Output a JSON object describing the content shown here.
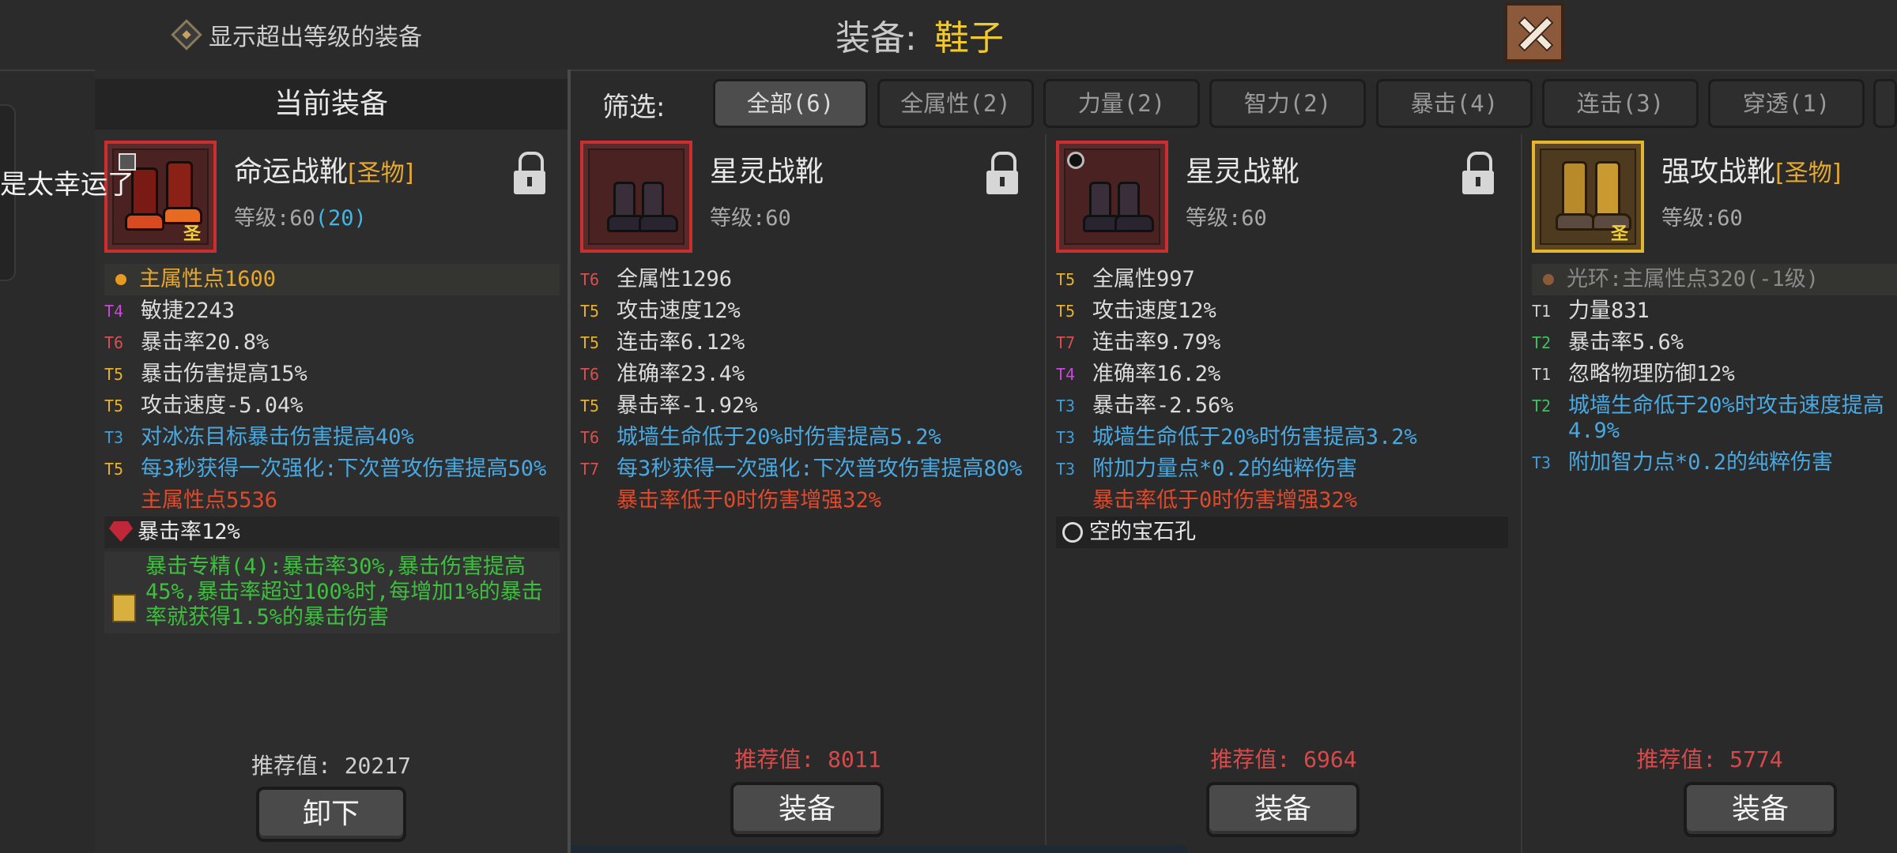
{
  "header": {
    "show_over_level_label": "显示超出等级的装备",
    "title_prefix": "装备:",
    "title_category": "鞋子",
    "close_icon": "close-x-icon"
  },
  "left_overlay_text": "是太幸运了",
  "current": {
    "header": "当前装备",
    "item": {
      "name": "命运战靴",
      "relic_tag": "[圣物]",
      "holy_mark": "圣",
      "level_prefix": "等级:60",
      "level_extra": "(20)",
      "frame_color": "#c92f2f",
      "stats": [
        {
          "tier": "",
          "text": "主属性点1600",
          "color": "#e6a830",
          "marker": "orb",
          "highlight": true
        },
        {
          "tier": "T4",
          "tier_color": "#c84ad8",
          "text": "敏捷2243",
          "color": "#dcdcdc"
        },
        {
          "tier": "T6",
          "tier_color": "#d85050",
          "text": "暴击率20.8%",
          "color": "#dcdcdc"
        },
        {
          "tier": "T5",
          "tier_color": "#e6b030",
          "text": "暴击伤害提高15%",
          "color": "#dcdcdc"
        },
        {
          "tier": "T5",
          "tier_color": "#e6b030",
          "text": "攻击速度-5.04%",
          "color": "#dcdcdc"
        },
        {
          "tier": "T3",
          "tier_color": "#3f9ed8",
          "text": "对冰冻目标暴击伤害提高40%",
          "color": "#4aa8e0"
        },
        {
          "tier": "T5",
          "tier_color": "#e6b030",
          "text": "每3秒获得一次强化:下次普攻伤害提高50%",
          "color": "#4aa8e0"
        },
        {
          "tier": "",
          "text": "主属性点5536",
          "color": "#e04a2a"
        }
      ],
      "gem": {
        "label": "暴击率12%"
      },
      "set_bonus": "暴击专精(4):暴击率30%,暴击伤害提高45%,暴击率超过100%时,每增加1%的暴击率就获得1.5%的暴击伤害"
    },
    "recommend": "推荐值: 20217",
    "button": "卸下"
  },
  "filter": {
    "label": "筛选:",
    "tabs": [
      {
        "label": "全部(6)",
        "active": true
      },
      {
        "label": "全属性(2)",
        "active": false
      },
      {
        "label": "力量(2)",
        "active": false
      },
      {
        "label": "智力(2)",
        "active": false
      },
      {
        "label": "暴击(4)",
        "active": false
      },
      {
        "label": "连击(3)",
        "active": false
      },
      {
        "label": "穿透(1)",
        "active": false
      }
    ]
  },
  "cards": [
    {
      "name": "星灵战靴",
      "relic_tag": "",
      "level": "等级:60",
      "stats": [
        {
          "tier": "T6",
          "tier_color": "#d85050",
          "text": "全属性1296",
          "color": "#dcdcdc"
        },
        {
          "tier": "T5",
          "tier_color": "#e6b030",
          "text": "攻击速度12%",
          "color": "#dcdcdc"
        },
        {
          "tier": "T5",
          "tier_color": "#e6b030",
          "text": "连击率6.12%",
          "color": "#dcdcdc"
        },
        {
          "tier": "T6",
          "tier_color": "#d85050",
          "text": "准确率23.4%",
          "color": "#dcdcdc"
        },
        {
          "tier": "T5",
          "tier_color": "#e6b030",
          "text": "暴击率-1.92%",
          "color": "#dcdcdc"
        },
        {
          "tier": "T6",
          "tier_color": "#d85050",
          "text": "城墙生命低于20%时伤害提高5.2%",
          "color": "#4aa8e0"
        },
        {
          "tier": "T7",
          "tier_color": "#d85050",
          "text": "每3秒获得一次强化:下次普攻伤害提高80%",
          "color": "#4aa8e0"
        },
        {
          "tier": "",
          "text": "暴击率低于0时伤害增强32%",
          "color": "#e04a2a"
        }
      ],
      "recommend": "推荐值: 8011",
      "button": "装备"
    },
    {
      "name": "星灵战靴",
      "relic_tag": "",
      "level": "等级:60",
      "stats": [
        {
          "tier": "T5",
          "tier_color": "#e6b030",
          "text": "全属性997",
          "color": "#dcdcdc"
        },
        {
          "tier": "T5",
          "tier_color": "#e6b030",
          "text": "攻击速度12%",
          "color": "#dcdcdc"
        },
        {
          "tier": "T7",
          "tier_color": "#d85050",
          "text": "连击率9.79%",
          "color": "#dcdcdc"
        },
        {
          "tier": "T4",
          "tier_color": "#c84ad8",
          "text": "准确率16.2%",
          "color": "#dcdcdc"
        },
        {
          "tier": "T3",
          "tier_color": "#3f9ed8",
          "text": "暴击率-2.56%",
          "color": "#dcdcdc"
        },
        {
          "tier": "T3",
          "tier_color": "#3f9ed8",
          "text": "城墙生命低于20%时伤害提高3.2%",
          "color": "#4aa8e0"
        },
        {
          "tier": "T3",
          "tier_color": "#3f9ed8",
          "text": "附加力量点*0.2的纯粹伤害",
          "color": "#4aa8e0"
        },
        {
          "tier": "",
          "text": "暴击率低于0时伤害增强32%",
          "color": "#e04a2a"
        }
      ],
      "socket": "空的宝石孔",
      "recommend": "推荐值: 6964",
      "button": "装备"
    },
    {
      "name": "强攻战靴",
      "relic_tag": "[圣物]",
      "holy_mark": "圣",
      "level": "等级:60",
      "stats": [
        {
          "tier": "",
          "text": "光环:主属性点320(-1级)",
          "color": "#8a8a8a",
          "marker": "orb-dim",
          "highlight": true
        },
        {
          "tier": "T1",
          "tier_color": "#cfcfcf",
          "text": "力量831",
          "color": "#dcdcdc"
        },
        {
          "tier": "T2",
          "tier_color": "#40c060",
          "text": "暴击率5.6%",
          "color": "#dcdcdc"
        },
        {
          "tier": "T1",
          "tier_color": "#cfcfcf",
          "text": "忽略物理防御12%",
          "color": "#dcdcdc"
        },
        {
          "tier": "T2",
          "tier_color": "#40c060",
          "text": "城墙生命低于20%时攻击速度提高4.9%",
          "color": "#4aa8e0"
        },
        {
          "tier": "T3",
          "tier_color": "#3f9ed8",
          "text": "附加智力点*0.2的纯粹伤害",
          "color": "#4aa8e0"
        }
      ],
      "recommend": "推荐值: 5774",
      "button": "装备"
    }
  ]
}
